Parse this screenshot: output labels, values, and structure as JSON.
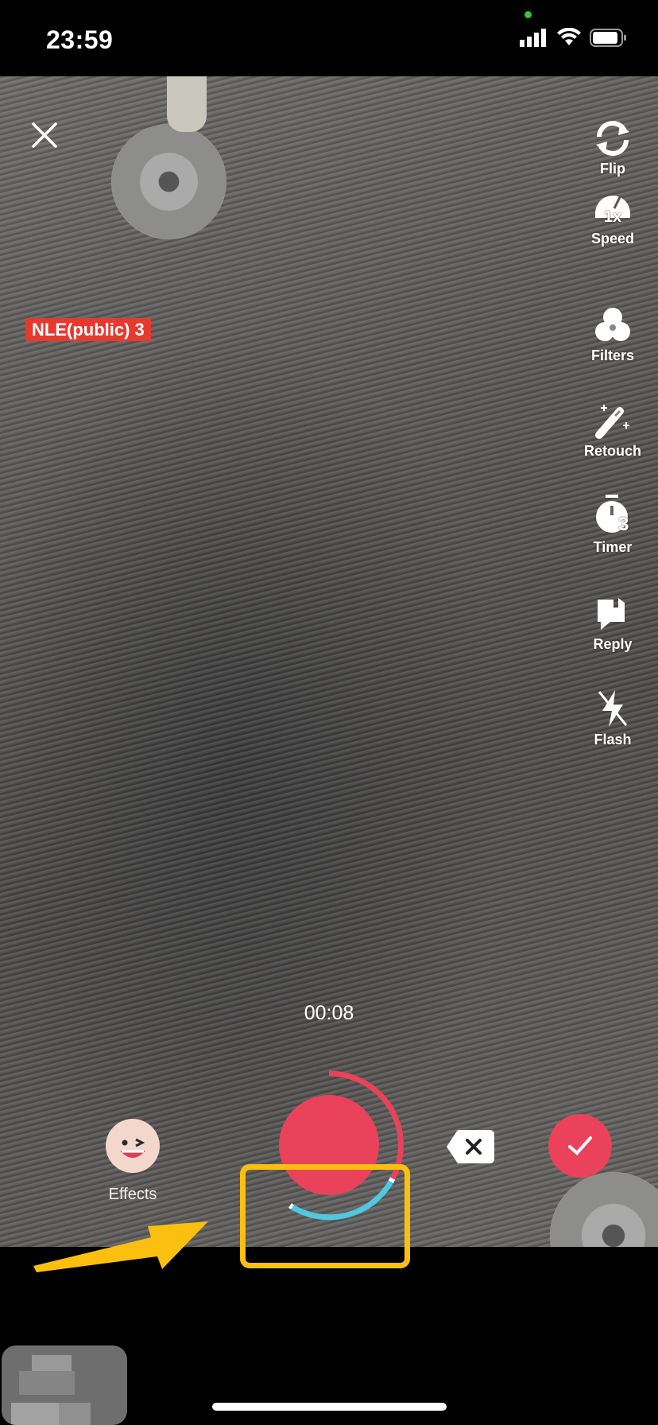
{
  "status_bar": {
    "time": "23:59",
    "icons": [
      "signal-icon",
      "wifi-icon",
      "battery-icon"
    ]
  },
  "camera": {
    "close_icon": "close-icon",
    "tag": "NLE(public) 3",
    "tools": [
      {
        "label": "Flip",
        "icon": "flip-camera-icon"
      },
      {
        "label": "Speed",
        "icon": "speed-icon",
        "badge": "1x"
      },
      {
        "label": "Filters",
        "icon": "filters-icon"
      },
      {
        "label": "Retouch",
        "icon": "retouch-wand-icon"
      },
      {
        "label": "Timer",
        "icon": "timer-icon",
        "badge": "3"
      },
      {
        "label": "Reply",
        "icon": "reply-icon"
      },
      {
        "label": "Flash",
        "icon": "flash-off-icon"
      }
    ],
    "record_time": "00:08",
    "effects_label": "Effects",
    "colors": {
      "accent": "#e9425a",
      "segment": "#4fc8e0",
      "highlight": "#fbbf10"
    }
  }
}
